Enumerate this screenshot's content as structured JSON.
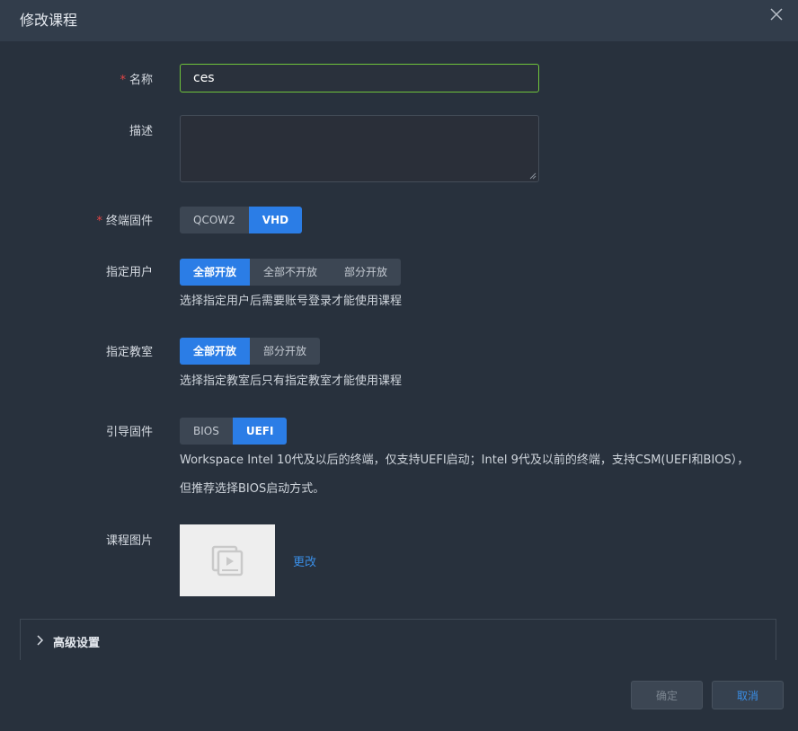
{
  "dialog": {
    "title": "修改课程"
  },
  "form": {
    "name": {
      "required_mark": "*",
      "label": "名称",
      "value": "ces"
    },
    "description": {
      "label": "描述",
      "value": ""
    },
    "firmware": {
      "required_mark": "*",
      "label": "终端固件",
      "options": [
        "QCOW2",
        "VHD"
      ],
      "selected": "VHD"
    },
    "users": {
      "label": "指定用户",
      "options": [
        "全部开放",
        "全部不开放",
        "部分开放"
      ],
      "selected": "全部开放",
      "hint": "选择指定用户后需要账号登录才能使用课程"
    },
    "classroom": {
      "label": "指定教室",
      "options": [
        "全部开放",
        "部分开放"
      ],
      "selected": "全部开放",
      "hint": "选择指定教室后只有指定教室才能使用课程"
    },
    "boot": {
      "label": "引导固件",
      "options": [
        "BIOS",
        "UEFI"
      ],
      "selected": "UEFI",
      "description": "Workspace Intel 10代及以后的终端，仅支持UEFI启动；Intel 9代及以前的终端，支持CSM(UEFI和BIOS），但推荐选择BIOS启动方式。"
    },
    "image": {
      "label": "课程图片",
      "change_link": "更改"
    }
  },
  "advanced": {
    "label": "高级设置"
  },
  "footer": {
    "ok_label": "确定",
    "cancel_label": "取消"
  },
  "colors": {
    "accent": "#2b7de6",
    "link": "#3a8ee6",
    "required": "#e54545",
    "input_focus": "#6fc33b"
  }
}
